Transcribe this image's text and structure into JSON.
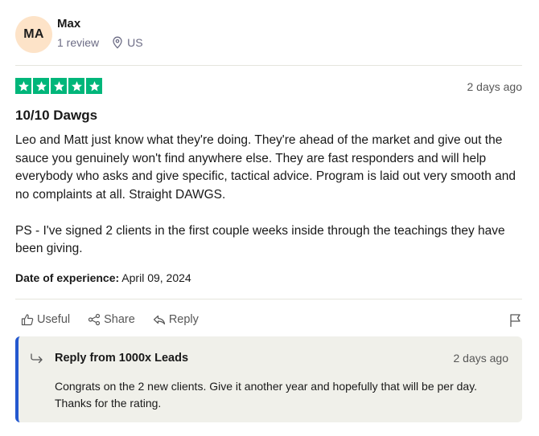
{
  "reviewer": {
    "initials": "MA",
    "name": "Max",
    "review_count": "1 review",
    "location": "US"
  },
  "review": {
    "rating": 5,
    "date": "2 days ago",
    "title": "10/10 Dawgs",
    "body": "Leo and Matt just know what they're doing. They're ahead of the market and give out the sauce you genuinely won't find anywhere else. They are fast responders and will help everybody who asks and give specific, tactical advice. Program is laid out very smooth and no complaints at all. Straight DAWGS.\n\nPS - I've signed 2 clients in the first couple weeks inside through the teachings they have been giving.",
    "experience_label": "Date of experience:",
    "experience_date": "April 09, 2024"
  },
  "actions": {
    "useful": "Useful",
    "share": "Share",
    "reply": "Reply"
  },
  "company_reply": {
    "title": "Reply from 1000x Leads",
    "date": "2 days ago",
    "text": "Congrats on the 2 new clients. Give it another year and hopefully that will be per day. Thanks for the rating."
  },
  "colors": {
    "star_green": "#00b67a",
    "reply_accent": "#2458cf",
    "avatar_bg": "#fde3c8"
  },
  "icons": [
    "location-pin-icon",
    "star-icon",
    "thumbs-up-icon",
    "share-icon",
    "reply-arrow-icon",
    "flag-icon"
  ]
}
